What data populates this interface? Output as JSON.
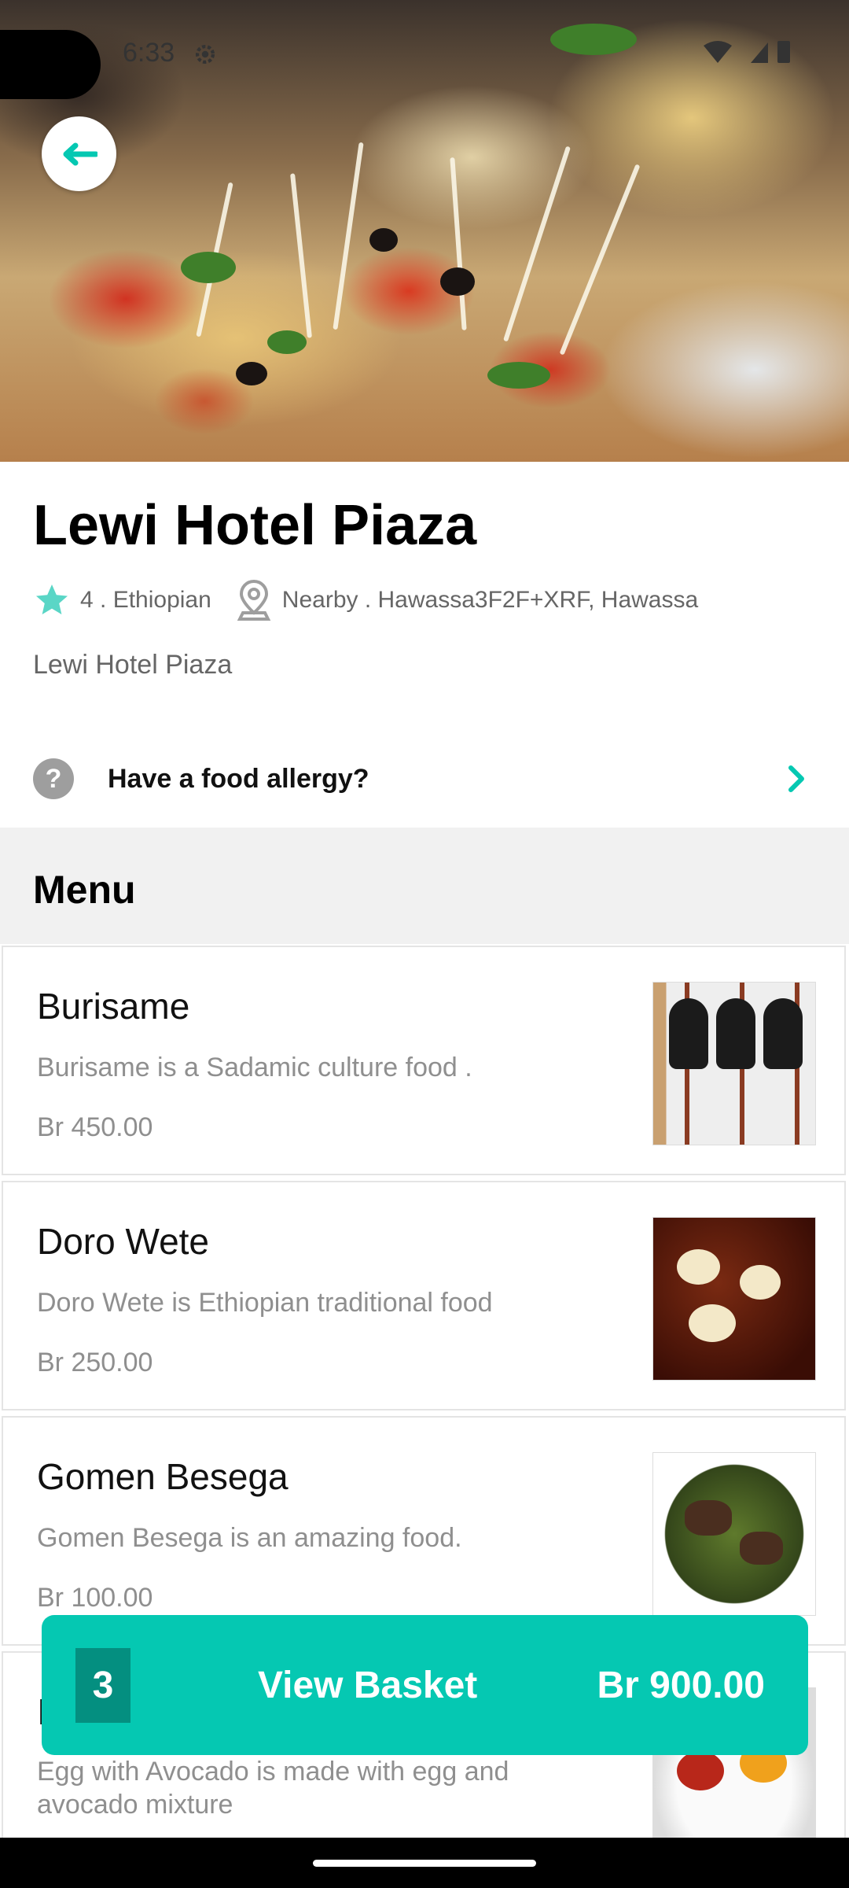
{
  "status_bar": {
    "time": "6:33"
  },
  "restaurant": {
    "name": "Lewi Hotel Piaza",
    "rating_cuisine": "4 . Ethiopian",
    "location": "Nearby . Hawassa3F2F+XRF, Hawassa",
    "subtitle": "Lewi Hotel Piaza"
  },
  "allergy": {
    "label": "Have a food allergy?",
    "icon": "?"
  },
  "menu": {
    "title": "Menu",
    "items": [
      {
        "name": "Burisame",
        "description": " Burisame is a Sadamic culture food .",
        "price": "Br 450.00"
      },
      {
        "name": "Doro Wete",
        "description": " Doro Wete is Ethiopian traditional food",
        "price": "Br 250.00"
      },
      {
        "name": "Gomen Besega",
        "description": " Gomen Besega is an amazing food.",
        "price": "Br 100.00"
      },
      {
        "name": "I",
        "description": " Egg with Avocado is made with egg and avocado mixture",
        "price": ""
      }
    ]
  },
  "basket": {
    "count": "3",
    "label": "View Basket",
    "total": "Br 900.00"
  },
  "colors": {
    "accent": "#05c8b2",
    "accent_dark": "#048f80",
    "menu_bg": "#f1f1f1"
  },
  "icons": [
    "back-arrow-icon",
    "star-icon",
    "location-pin-icon",
    "help-icon",
    "chevron-right-icon",
    "settings-gear-icon",
    "wifi-icon",
    "signal-icon",
    "battery-icon"
  ]
}
